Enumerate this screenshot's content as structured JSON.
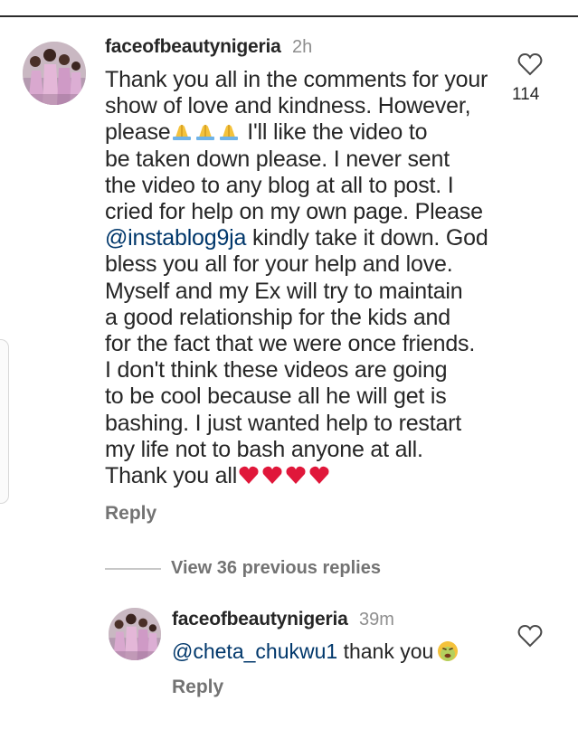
{
  "comment": {
    "username": "faceofbeautynigeria",
    "time": "2h",
    "like_count": "114",
    "lines": [
      "Thank you all in the comments for your",
      "show of love and kindness. However,",
      "please",
      " I'll like the video to",
      "be taken down please. I never sent",
      "the video to any blog at all to post. I",
      "cried for help on my own page. Please",
      "@instablog9ja",
      " kindly take it down. God",
      "bless you all for your help and love.",
      "Myself and my Ex will try to maintain",
      "a good relationship for the kids and",
      "for the fact that we were once friends.",
      "I don't think these videos are going",
      "to be cool because all he will get is",
      "bashing. I just wanted help to restart",
      "my life not to bash anyone at all.",
      "Thank you all"
    ],
    "reply_label": "Reply"
  },
  "view_replies_label": "View 36 previous replies",
  "reply": {
    "username": "faceofbeautynigeria",
    "time": "39m",
    "mention": "@cheta_chukwu1",
    "text": " thank you",
    "reply_label": "Reply"
  },
  "colors": {
    "text": "#262626",
    "secondary": "#8e8e8e",
    "link": "#00376b",
    "heart_emoji": "#e0173a",
    "pray_emoji": "#f4c23c"
  },
  "icons": [
    "heart-outline-icon",
    "folded-hands-emoji",
    "red-heart-emoji",
    "sick-face-emoji"
  ]
}
